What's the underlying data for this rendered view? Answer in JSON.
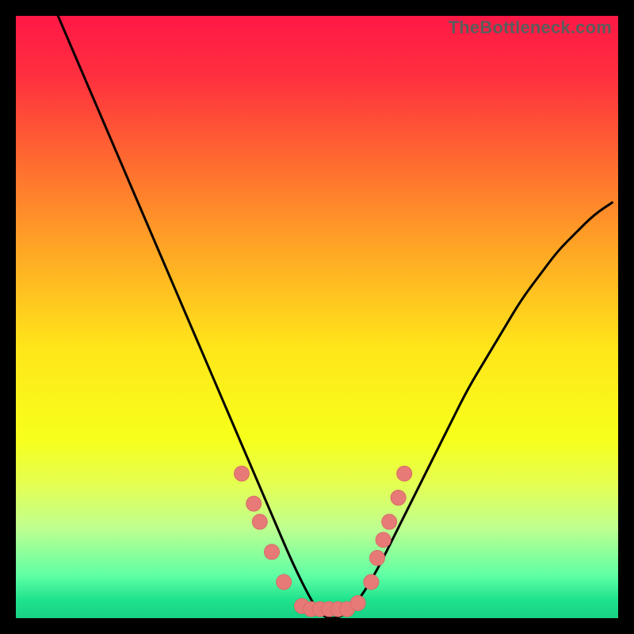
{
  "watermark": "TheBottleneck.com",
  "colors": {
    "gradient_stops": [
      {
        "offset": 0.0,
        "color": "#ff1846"
      },
      {
        "offset": 0.1,
        "color": "#ff2f3f"
      },
      {
        "offset": 0.25,
        "color": "#ff6e2f"
      },
      {
        "offset": 0.4,
        "color": "#ffab24"
      },
      {
        "offset": 0.55,
        "color": "#ffe51a"
      },
      {
        "offset": 0.7,
        "color": "#f7ff1a"
      },
      {
        "offset": 0.78,
        "color": "#e4ff54"
      },
      {
        "offset": 0.85,
        "color": "#bfff90"
      },
      {
        "offset": 0.93,
        "color": "#5effa5"
      },
      {
        "offset": 0.97,
        "color": "#1fe28d"
      },
      {
        "offset": 1.0,
        "color": "#17d183"
      }
    ],
    "curve": "#000000",
    "marker_fill": "#e77a77",
    "marker_stroke": "#d86b67"
  },
  "chart_data": {
    "type": "line",
    "title": "",
    "xlabel": "",
    "ylabel": "",
    "xlim": [
      0,
      100
    ],
    "ylim": [
      0,
      100
    ],
    "series": [
      {
        "name": "bottleneck-curve",
        "x": [
          7,
          10,
          13,
          16,
          19,
          22,
          25,
          28,
          31,
          34,
          37,
          40,
          43,
          46,
          49,
          51,
          54,
          57,
          60,
          63,
          66,
          69,
          72,
          75,
          78,
          81,
          84,
          87,
          90,
          93,
          96,
          99
        ],
        "y": [
          100,
          93,
          86,
          79,
          72,
          65,
          58,
          51,
          44,
          37,
          30,
          23,
          16,
          9,
          3,
          0,
          0,
          3,
          8,
          14,
          20,
          26,
          32,
          38,
          43,
          48,
          53,
          57,
          61,
          64,
          67,
          69
        ]
      }
    ],
    "markers": [
      {
        "x": 37.5,
        "y": 24
      },
      {
        "x": 39.5,
        "y": 19
      },
      {
        "x": 40.5,
        "y": 16
      },
      {
        "x": 42.5,
        "y": 11
      },
      {
        "x": 44.5,
        "y": 6
      },
      {
        "x": 47.5,
        "y": 2
      },
      {
        "x": 49.0,
        "y": 1.5
      },
      {
        "x": 50.5,
        "y": 1.5
      },
      {
        "x": 52.0,
        "y": 1.5
      },
      {
        "x": 53.5,
        "y": 1.5
      },
      {
        "x": 55.0,
        "y": 1.5
      },
      {
        "x": 56.8,
        "y": 2.5
      },
      {
        "x": 59.0,
        "y": 6
      },
      {
        "x": 60.0,
        "y": 10
      },
      {
        "x": 61.0,
        "y": 13
      },
      {
        "x": 62.0,
        "y": 16
      },
      {
        "x": 63.5,
        "y": 20
      },
      {
        "x": 64.5,
        "y": 24
      }
    ]
  }
}
